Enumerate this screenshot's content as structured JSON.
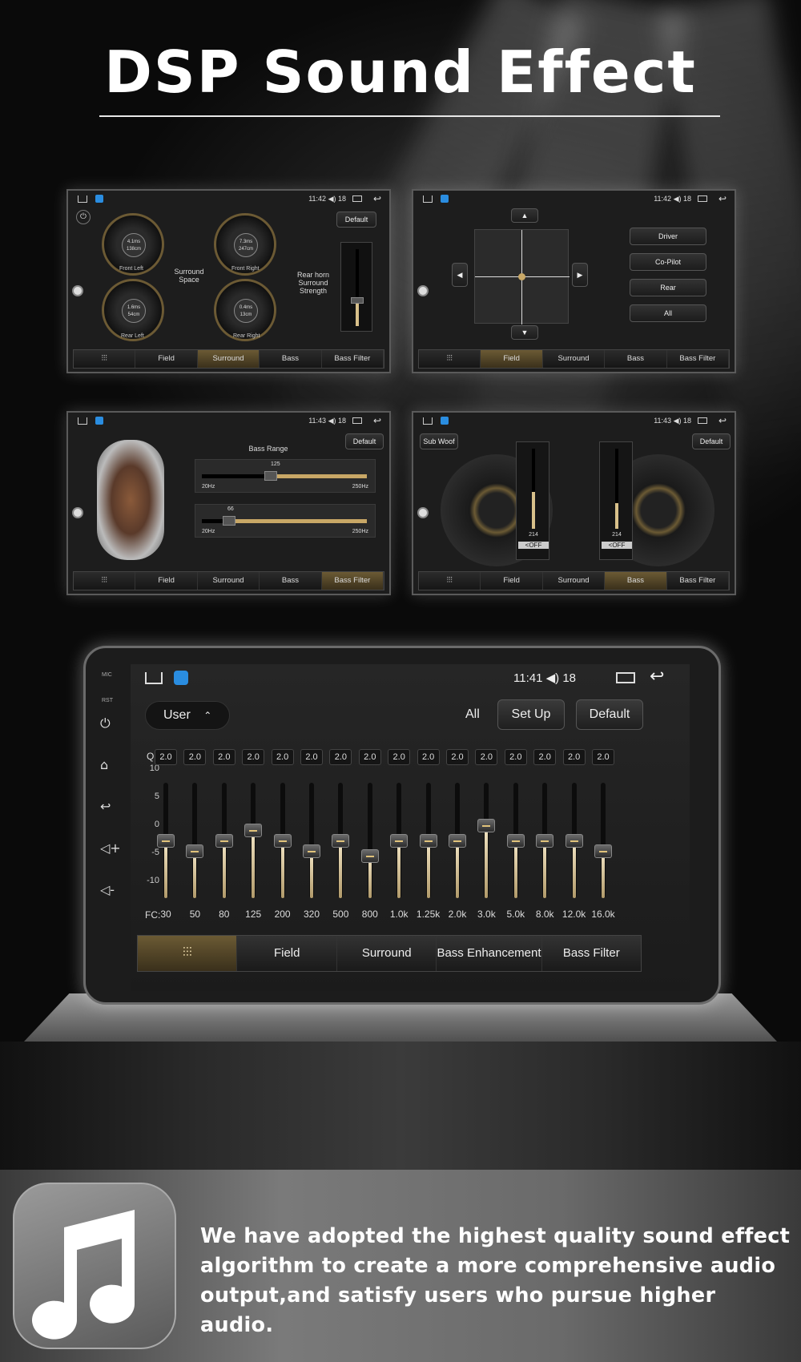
{
  "title": "DSP Sound Effect",
  "shared_tabs": [
    "Field",
    "Surround",
    "Bass Enhancement",
    "Bass Filter"
  ],
  "shot1": {
    "time": "11:42",
    "vol": "18",
    "default": "Default",
    "surround_space": "Surround Space",
    "rear_horn": "Rear horn Surround Strength",
    "gauges": [
      {
        "label": "Front Left",
        "v1": "4.1ms",
        "v2": "138cm"
      },
      {
        "label": "Front Right",
        "v1": "7.3ms",
        "v2": "247cm"
      },
      {
        "label": "Rear Left",
        "v1": "1.6ms",
        "v2": "54cm"
      },
      {
        "label": "Rear Right",
        "v1": "0.4ms",
        "v2": "13cm"
      }
    ],
    "active_tab": "Surround"
  },
  "shot2": {
    "time": "11:42",
    "vol": "18",
    "buttons": [
      "Driver",
      "Co-Pilot",
      "Rear",
      "All"
    ],
    "active_tab": "Field"
  },
  "shot3": {
    "time": "11:43",
    "vol": "18",
    "default": "Default",
    "bass_range": "Bass Range",
    "s1_value": "125",
    "s2_value": "66",
    "min": "20Hz",
    "max": "250Hz",
    "active_tab": "Bass Filter"
  },
  "shot4": {
    "time": "11:43",
    "vol": "18",
    "default": "Default",
    "subwoof": "Sub Woof",
    "off": "<OFF",
    "rate": "214",
    "active_tab": "Bass Enhancement"
  },
  "main": {
    "time": "11:41",
    "vol": "18",
    "preset": "User",
    "all": "All",
    "setup": "Set Up",
    "default": "Default",
    "side": {
      "mic": "MIC",
      "rst": "RST"
    },
    "q_label": "Q:",
    "fc_label": "FC:",
    "y_ticks": [
      "10",
      "5",
      "0",
      "-5",
      "-10"
    ],
    "bands": [
      {
        "fc": "30",
        "q": "2.0",
        "gain": 0
      },
      {
        "fc": "50",
        "q": "2.0",
        "gain": -2
      },
      {
        "fc": "80",
        "q": "2.0",
        "gain": 0
      },
      {
        "fc": "125",
        "q": "2.0",
        "gain": 2
      },
      {
        "fc": "200",
        "q": "2.0",
        "gain": 0
      },
      {
        "fc": "320",
        "q": "2.0",
        "gain": -2
      },
      {
        "fc": "500",
        "q": "2.0",
        "gain": 0
      },
      {
        "fc": "800",
        "q": "2.0",
        "gain": -3
      },
      {
        "fc": "1.0k",
        "q": "2.0",
        "gain": 0
      },
      {
        "fc": "1.25k",
        "q": "2.0",
        "gain": 0
      },
      {
        "fc": "2.0k",
        "q": "2.0",
        "gain": 0
      },
      {
        "fc": "3.0k",
        "q": "2.0",
        "gain": 3
      },
      {
        "fc": "5.0k",
        "q": "2.0",
        "gain": 0
      },
      {
        "fc": "8.0k",
        "q": "2.0",
        "gain": 0
      },
      {
        "fc": "12.0k",
        "q": "2.0",
        "gain": 0
      },
      {
        "fc": "16.0k",
        "q": "2.0",
        "gain": -2
      }
    ],
    "tabs": [
      "Field",
      "Surround",
      "Bass Enhancement",
      "Bass Filter"
    ]
  },
  "description": "We have adopted the highest quality sound effect algorithm to create a more comprehensive audio output,and satisfy users who pursue higher audio.",
  "colors": {
    "accent": "#c8a766",
    "bg": "#1b1b1b"
  }
}
